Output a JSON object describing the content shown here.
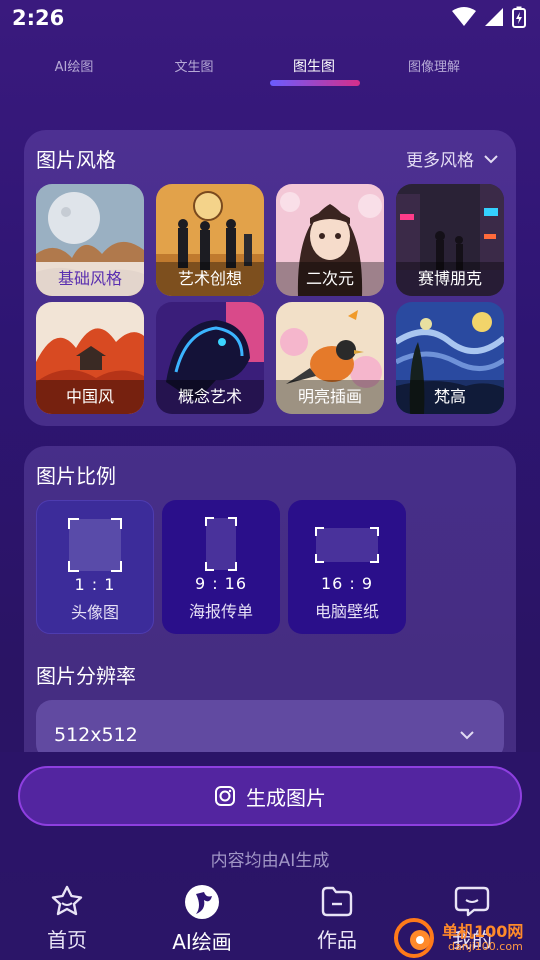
{
  "status_bar": {
    "time": "2:26"
  },
  "top_tabs": [
    {
      "label": "AI绘图",
      "active": false
    },
    {
      "label": "文生图",
      "active": false
    },
    {
      "label": "图生图",
      "active": true
    },
    {
      "label": "图像理解",
      "active": false
    }
  ],
  "style_section": {
    "title": "图片风格",
    "more_label": "更多风格",
    "styles": [
      {
        "label": "基础风格",
        "selected": true
      },
      {
        "label": "艺术创想",
        "selected": false
      },
      {
        "label": "二次元",
        "selected": false
      },
      {
        "label": "赛博朋克",
        "selected": false
      },
      {
        "label": "中国风",
        "selected": false
      },
      {
        "label": "概念艺术",
        "selected": false
      },
      {
        "label": "明亮插画",
        "selected": false
      },
      {
        "label": "梵高",
        "selected": false
      }
    ]
  },
  "ratio_section": {
    "title": "图片比例",
    "options": [
      {
        "value": "1 : 1",
        "name": "头像图",
        "selected": true
      },
      {
        "value": "9 : 16",
        "name": "海报传单",
        "selected": false
      },
      {
        "value": "16 : 9",
        "name": "电脑壁纸",
        "selected": false
      }
    ]
  },
  "resolution_section": {
    "title": "图片分辨率",
    "value": "512x512"
  },
  "generate_button": {
    "label": "生成图片"
  },
  "disclaimer": "内容均由AI生成",
  "bottom_nav": [
    {
      "label": "首页",
      "icon": "star-home-icon",
      "active": false
    },
    {
      "label": "AI绘画",
      "icon": "ai-paint-icon",
      "active": true
    },
    {
      "label": "作品",
      "icon": "folder-icon",
      "active": false
    },
    {
      "label": "我的",
      "icon": "chat-profile-icon",
      "active": false
    }
  ],
  "watermark": {
    "text": "单机100网",
    "sub": "danji100.com"
  },
  "colors": {
    "accent_gradient_start": "#6a5cff",
    "accent_gradient_end": "#d52e8a",
    "button_border": "#8e3fe0"
  }
}
